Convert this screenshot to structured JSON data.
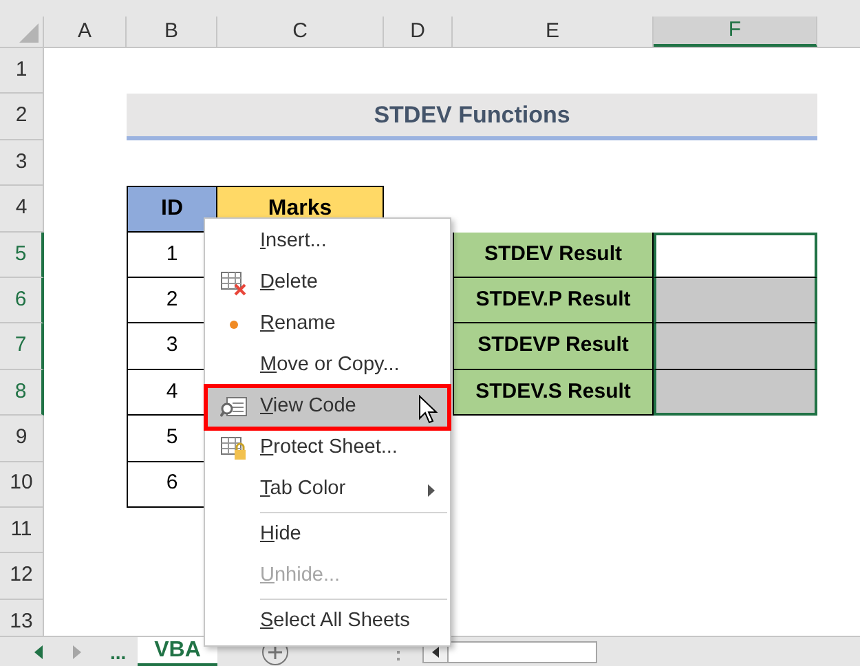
{
  "columns": [
    {
      "label": "A",
      "selected": false
    },
    {
      "label": "B",
      "selected": false
    },
    {
      "label": "C",
      "selected": false
    },
    {
      "label": "D",
      "selected": false
    },
    {
      "label": "E",
      "selected": false
    },
    {
      "label": "F",
      "selected": true
    }
  ],
  "rows": [
    {
      "label": "1",
      "selected": false
    },
    {
      "label": "2",
      "selected": false
    },
    {
      "label": "3",
      "selected": false
    },
    {
      "label": "4",
      "selected": false
    },
    {
      "label": "5",
      "selected": true
    },
    {
      "label": "6",
      "selected": true
    },
    {
      "label": "7",
      "selected": true
    },
    {
      "label": "8",
      "selected": true
    },
    {
      "label": "9",
      "selected": false
    },
    {
      "label": "10",
      "selected": false
    },
    {
      "label": "11",
      "selected": false
    },
    {
      "label": "12",
      "selected": false
    },
    {
      "label": "13",
      "selected": false
    }
  ],
  "title": "STDEV Functions",
  "table": {
    "headers": [
      "ID",
      "Marks"
    ],
    "ids": [
      "1",
      "2",
      "3",
      "4",
      "5",
      "6"
    ]
  },
  "results": [
    {
      "label": "STDEV Result",
      "active": true
    },
    {
      "label": "STDEV.P Result",
      "active": false
    },
    {
      "label": "STDEVP Result",
      "active": false
    },
    {
      "label": "STDEV.S Result",
      "active": false
    }
  ],
  "context_menu": [
    {
      "label": "Insert...",
      "selected": false,
      "disabled": false,
      "submenu": false,
      "separator_before": false,
      "highlighted": false
    },
    {
      "label": "Delete",
      "selected": false,
      "disabled": false,
      "submenu": false,
      "separator_before": false,
      "highlighted": false
    },
    {
      "label": "Rename",
      "selected": false,
      "disabled": false,
      "submenu": false,
      "separator_before": false,
      "highlighted": false
    },
    {
      "label": "Move or Copy...",
      "selected": false,
      "disabled": false,
      "submenu": false,
      "separator_before": false,
      "highlighted": false
    },
    {
      "label": "View Code",
      "selected": true,
      "disabled": false,
      "submenu": false,
      "separator_before": false,
      "highlighted": true
    },
    {
      "label": "Protect Sheet...",
      "selected": false,
      "disabled": false,
      "submenu": false,
      "separator_before": false,
      "highlighted": false
    },
    {
      "label": "Tab Color",
      "selected": false,
      "disabled": false,
      "submenu": true,
      "separator_before": false,
      "highlighted": false
    },
    {
      "label": "Hide",
      "selected": false,
      "disabled": false,
      "submenu": false,
      "separator_before": true,
      "highlighted": false
    },
    {
      "label": "Unhide...",
      "selected": false,
      "disabled": true,
      "submenu": false,
      "separator_before": false,
      "highlighted": false
    },
    {
      "label": "Select All Sheets",
      "selected": false,
      "disabled": false,
      "submenu": false,
      "separator_before": true,
      "highlighted": false
    }
  ],
  "sheet_nav": "...",
  "sheet_tabs": [
    {
      "label": "VBA",
      "selected": true
    }
  ]
}
